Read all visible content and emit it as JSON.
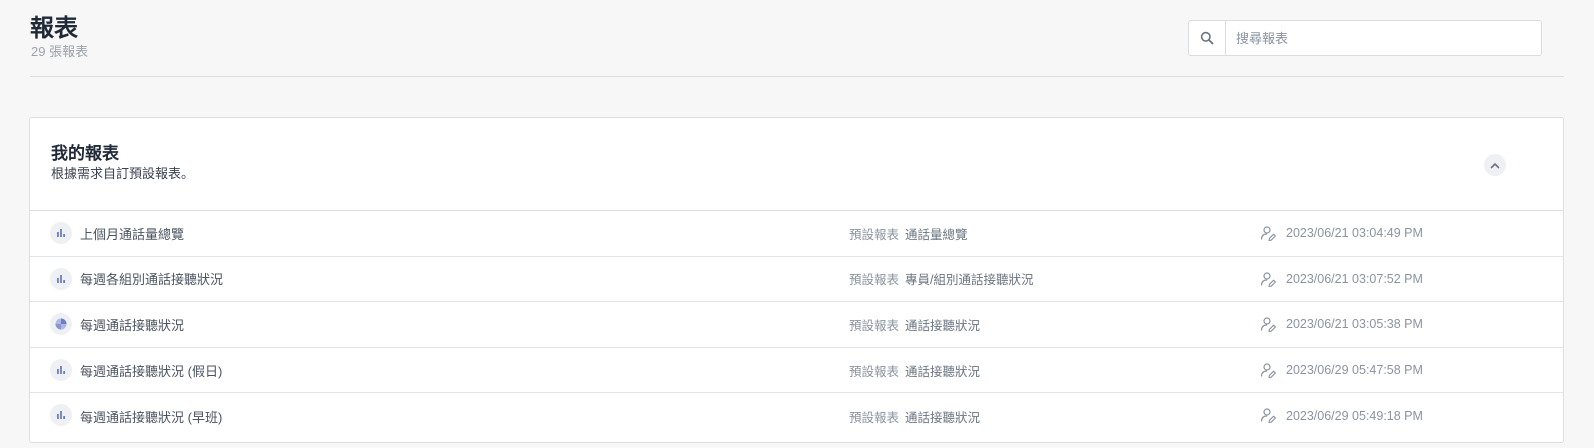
{
  "header": {
    "title": "報表",
    "subtitle": "29 張報表"
  },
  "search": {
    "icon": "search-icon",
    "placeholder": "搜尋報表",
    "value": ""
  },
  "section": {
    "title": "我的報表",
    "description": "根據需求自訂預設報表。",
    "collapse_icon": "chevron-up-icon"
  },
  "reports": [
    {
      "icon": "bar-chart-icon",
      "name": "上個月通話量總覽",
      "type_label": "預設報表",
      "template": "通話量總覽",
      "owner_icon": "user-edit-icon",
      "updated": "2023/06/21 03:04:49 PM"
    },
    {
      "icon": "bar-chart-icon",
      "name": "每週各組別通話接聽狀況",
      "type_label": "預設報表",
      "template": "專員/組別通話接聽狀況",
      "owner_icon": "user-edit-icon",
      "updated": "2023/06/21 03:07:52 PM"
    },
    {
      "icon": "pie-chart-icon",
      "name": "每週通話接聽狀況",
      "type_label": "預設報表",
      "template": "通話接聽狀況",
      "owner_icon": "user-edit-icon",
      "updated": "2023/06/21 03:05:38 PM"
    },
    {
      "icon": "bar-chart-icon",
      "name": "每週通話接聽狀況 (假日)",
      "type_label": "預設報表",
      "template": "通話接聽狀況",
      "owner_icon": "user-edit-icon",
      "updated": "2023/06/29 05:47:58 PM"
    },
    {
      "icon": "bar-chart-icon",
      "name": "每週通話接聽狀況 (早班)",
      "type_label": "預設報表",
      "template": "通話接聽狀況",
      "owner_icon": "user-edit-icon",
      "updated": "2023/06/29 05:49:18 PM"
    }
  ],
  "colors": {
    "icon_accent": "#6b7fc4",
    "muted_text": "#8a94a0"
  }
}
